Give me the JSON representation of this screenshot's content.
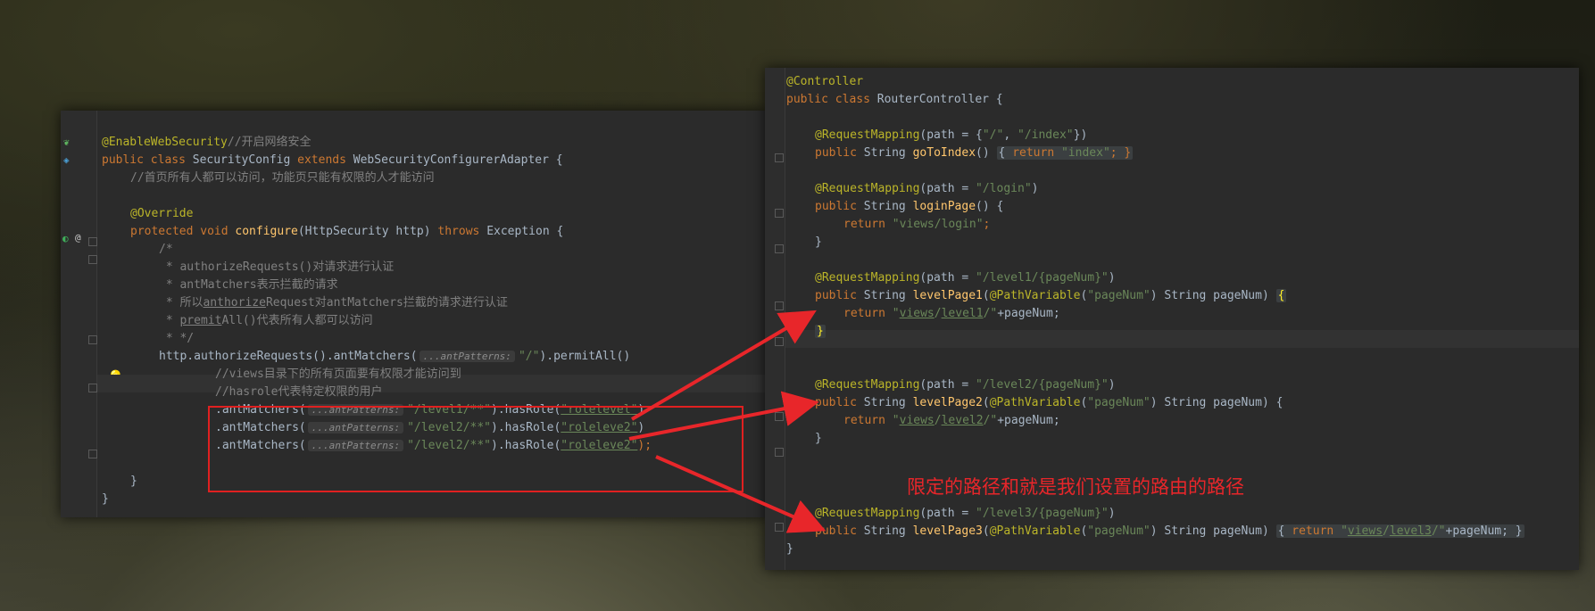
{
  "left_code": {
    "l1_ann": "@EnableWebSecurity",
    "l1_cm": "//开启网络安全",
    "l2_a": "public class ",
    "l2_b": "SecurityConfig ",
    "l2_c": "extends ",
    "l2_d": "WebSecurityConfigurerAdapter {",
    "l3": "//首页所有人都可以访问，功能页只能有权限的人才能访问",
    "l4": "@Override",
    "l5_a": "protected void ",
    "l5_b": "configure",
    "l5_c": "(HttpSecurity http) ",
    "l5_d": "throws ",
    "l5_e": "Exception {",
    "l6": "/*",
    "l7_a": " * authorizeRequests()",
    "l7_b": "对请求进行认证",
    "l8_a": " * antMatchers",
    "l8_b": "表示拦截的请求",
    "l9_a": " * 所以",
    "l9_b": "anthorize",
    "l9_c": "Request",
    "l9_d": "对",
    "l9_e": "antMatchers",
    "l9_f": "拦截的请求进行认证",
    "l10_a": " * ",
    "l10_b": "premit",
    "l10_c": "All()",
    "l10_d": "代表所有人都可以访问",
    "l11": " * */",
    "l12_a": "http.authorizeRequests().antMatchers(",
    "hint": "...antPatterns:",
    "l12_b": "\"/\"",
    "l12_c": ").permitAll()",
    "l13": "//views目录下的所有页面要有权限才能访问到",
    "l14": "//hasrole代表特定权限的用户",
    "l15_a": ".antMatchers(",
    "l15_b": "\"/level1/**\"",
    "l15_c": ").hasRole(",
    "l15_d": "\"rolelevel\"",
    "l15_e": ")",
    "l16_b": "\"/level2/**\"",
    "l16_d": "\"roleleve2\"",
    "l16_e": ")",
    "l17_b": "\"/level2/**\"",
    "l17_d": "\"roleleve2\"",
    "l17_e": ");",
    "l18": "}",
    "l19": "}"
  },
  "right_code": {
    "r1": "@Controller",
    "r2_a": "public class ",
    "r2_b": "RouterController {",
    "r3_ann": "@RequestMapping",
    "r3_a": "(path = {",
    "r3_b": "\"/\"",
    "r3_c": ", ",
    "r3_d": "\"/index\"",
    "r3_e": "})",
    "r4_a": "public ",
    "r4_b": "String ",
    "r4_c": "goToIndex",
    "r4_d": "() ",
    "r4_e": "{ ",
    "r4_f": "return ",
    "r4_g": "\"index\"",
    "r4_h": "; }",
    "r5_a": "(path = ",
    "r5_b": "\"/login\"",
    "r5_c": ")",
    "r6_c": "loginPage",
    "r6_d": "() {",
    "r7_a": "return ",
    "r7_b": "\"views/login\"",
    "r7_c": ";",
    "r8": "}",
    "r9_b": "\"/level1/{pageNum}\"",
    "r10_c": "levelPage1",
    "r10_d": "(",
    "r10_e": "@PathVariable",
    "r10_f": "(",
    "r10_g": "\"pageNum\"",
    "r10_h": ") String pageNum) ",
    "r10_i": "{",
    "r11_q": "\"",
    "r11_v": "views",
    "r11_s": "/",
    "r11_l1": "level1",
    "r11_s2": "/\"",
    "r11_t": "+pageNum;",
    "r12": "}",
    "r13_b": "\"/level2/{pageNum}\"",
    "r14_c": "levelPage2",
    "r14_h": ") String pageNum) {",
    "r15_l2": "level2",
    "r16": "}",
    "r17_b": "\"/level3/{pageNum}\"",
    "r18_c": "levelPage3",
    "r18_h": ") String pageNum) ",
    "r18_i": "{ ",
    "r18_l3": "level3",
    "r18_t": "+pageNum; }",
    "r19": "}"
  },
  "caption": "限定的路径和就是我们设置的路由的路径",
  "colors": {
    "editor_bg": "#2b2b2b",
    "annotation": "#bbb529",
    "keyword": "#cc7832",
    "string": "#6a8759",
    "comment": "#808080",
    "function": "#ffc66d",
    "text": "#a9b7c6",
    "highlight_red": "#e02020"
  }
}
